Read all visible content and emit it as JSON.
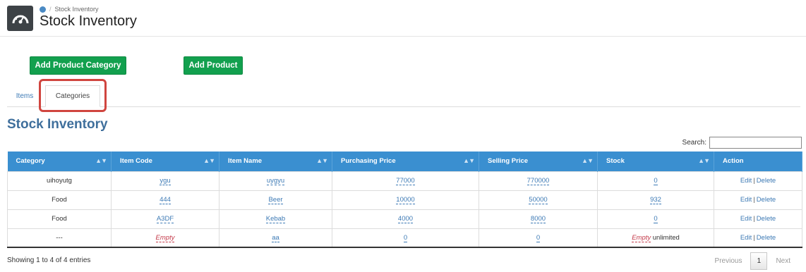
{
  "header": {
    "breadcrumb": "Stock Inventory",
    "title": "Stock Inventory"
  },
  "buttons": {
    "add_category": "Add Product Category",
    "add_product": "Add Product",
    "color": "#12a04e"
  },
  "tabs": {
    "items": "Items",
    "categories": "Categories",
    "active": "Categories"
  },
  "section_title": "Stock Inventory",
  "search": {
    "label": "Search:",
    "value": ""
  },
  "table": {
    "header_color": "#3a8fd0",
    "columns": [
      "Category",
      "Item Code",
      "Item Name",
      "Purchasing Price",
      "Selling Price",
      "Stock",
      "Action"
    ],
    "rows": [
      {
        "category": "uihoyutg",
        "code": "ygu",
        "name": "uygyu",
        "purchase": "77000",
        "selling": "770000",
        "stock": "0",
        "stock_suffix": ""
      },
      {
        "category": "Food",
        "code": "444",
        "name": "Beer",
        "purchase": "10000",
        "selling": "50000",
        "stock": "932",
        "stock_suffix": ""
      },
      {
        "category": "Food",
        "code": "A3DF",
        "name": "Kebab",
        "purchase": "4000",
        "selling": "8000",
        "stock": "0",
        "stock_suffix": ""
      },
      {
        "category": "---",
        "code": "Empty",
        "name": "aa",
        "purchase": "0",
        "selling": "0",
        "stock": "Empty",
        "stock_suffix": "unlimited"
      }
    ],
    "edit_label": "Edit",
    "delete_label": "Delete"
  },
  "footer": {
    "info": "Showing 1 to 4 of 4 entries",
    "previous": "Previous",
    "page": "1",
    "next": "Next"
  }
}
